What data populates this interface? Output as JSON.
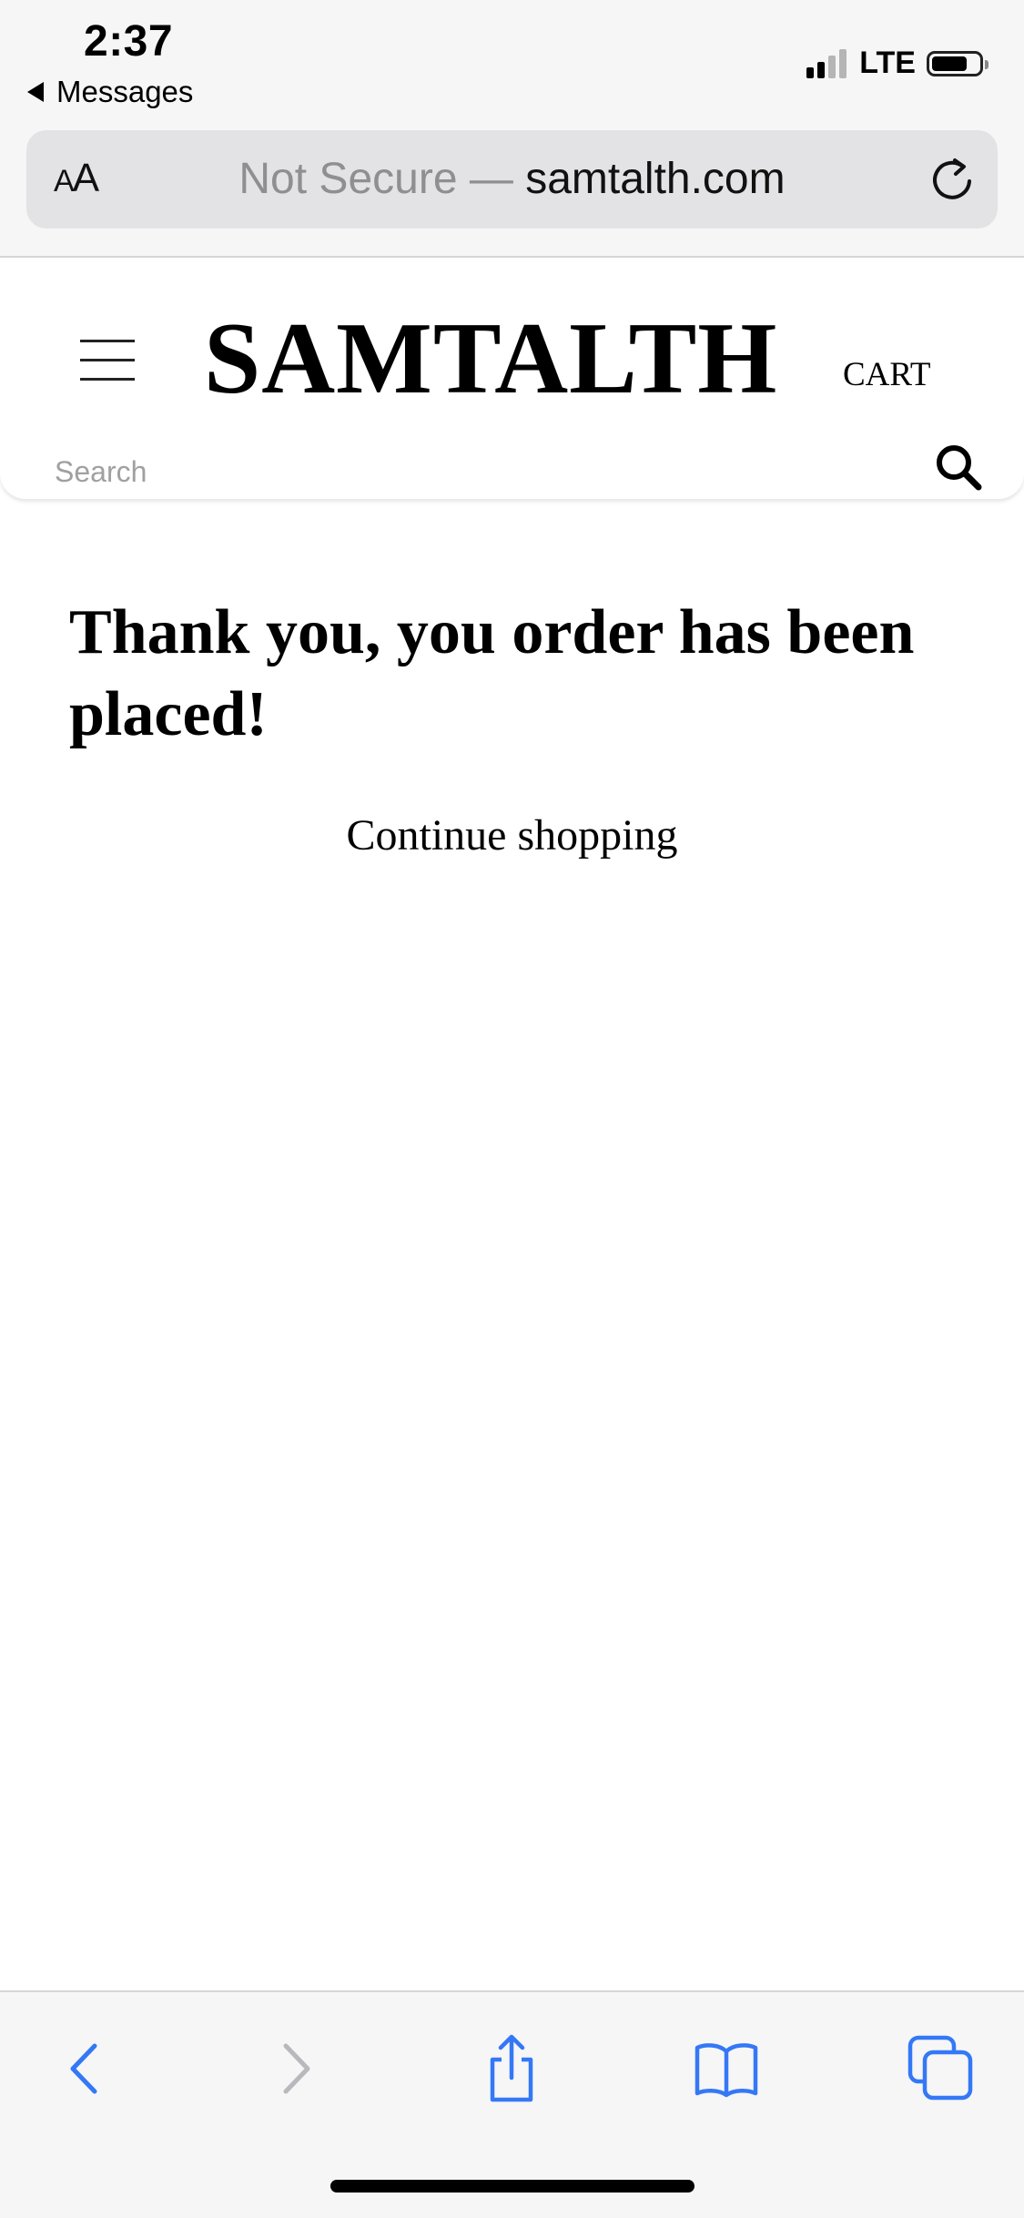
{
  "status_bar": {
    "time": "2:37",
    "back_app": "Messages",
    "network": "LTE",
    "signal_bars_active": 2,
    "signal_bars_total": 4,
    "battery_level": 0.75
  },
  "url_bar": {
    "aa_small": "A",
    "aa_large": "A",
    "security_label": "Not Secure —",
    "domain": "samtalth.com"
  },
  "site_header": {
    "brand": "SAMTALTH",
    "cart_label": "CART",
    "search_placeholder": "Search"
  },
  "main": {
    "confirmation_message": "Thank you, you order has been placed!",
    "continue_link": "Continue shopping"
  },
  "toolbar": {
    "back_icon": "chevron-left-icon",
    "forward_icon": "chevron-right-icon",
    "share_icon": "share-icon",
    "bookmarks_icon": "book-icon",
    "tabs_icon": "tabs-icon"
  },
  "colors": {
    "accent": "#3478f6",
    "disabled": "#b9b9bd",
    "chrome_background": "#f6f6f7",
    "url_bar_background": "#e3e3e5"
  }
}
